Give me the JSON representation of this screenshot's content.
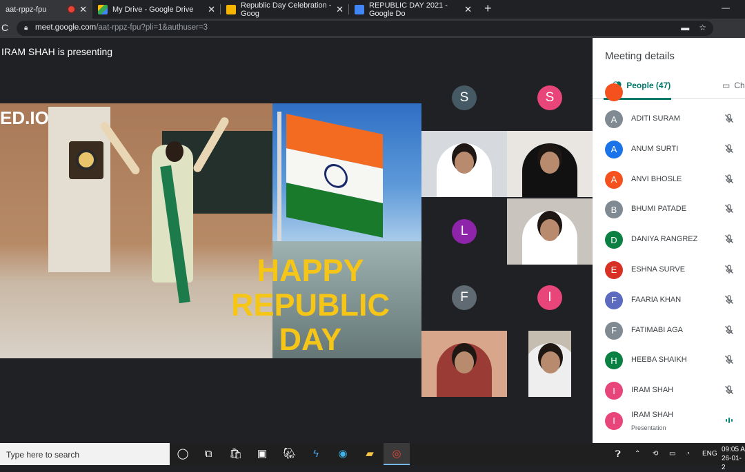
{
  "browser": {
    "tabs": [
      {
        "title": "aat-rppz-fpu",
        "active": true
      },
      {
        "title": "My Drive - Google Drive",
        "active": false
      },
      {
        "title": "Republic Day Celebration - Goog",
        "active": false
      },
      {
        "title": "REPUBLIC DAY 2021 - Google Do",
        "active": false
      }
    ],
    "new_tab": "+",
    "minimize": "—",
    "url_host": "meet.google.com",
    "url_path": "/aat-rppz-fpu?pli=1&authuser=3"
  },
  "meet": {
    "presenter_banner": "IRAM SHAH is presenting",
    "slide": {
      "brand_text": "ED.IO",
      "headline_lines": [
        "HAPPY",
        "REPUBLIC",
        "DAY"
      ]
    },
    "tiles": [
      {
        "type": "avatar",
        "letter": "S",
        "color": "#455a64"
      },
      {
        "type": "avatar",
        "letter": "S",
        "color": "#e8457a"
      },
      {
        "type": "video"
      },
      {
        "type": "video"
      },
      {
        "type": "avatar",
        "letter": "L",
        "color": "#8e24aa"
      },
      {
        "type": "video"
      },
      {
        "type": "avatar",
        "letter": "F",
        "color": "#5f6a72"
      },
      {
        "type": "avatar",
        "letter": "I",
        "color": "#e8457a"
      },
      {
        "type": "video"
      },
      {
        "type": "video"
      }
    ]
  },
  "panel": {
    "title": "Meeting details",
    "people_tab": "People (47)",
    "chat_tab": "Ch",
    "participants": [
      {
        "initial": "A",
        "name": "ADITI SURAM",
        "color": "#7f8a92",
        "sub": "",
        "muted": true
      },
      {
        "initial": "A",
        "name": "ANUM SURTI",
        "color": "#1a73e8",
        "sub": "",
        "muted": true
      },
      {
        "initial": "A",
        "name": "ANVI BHOSLE",
        "color": "#f4511e",
        "sub": "",
        "muted": true
      },
      {
        "initial": "B",
        "name": "BHUMI PATADE",
        "color": "#7f8a92",
        "sub": "",
        "muted": true
      },
      {
        "initial": "D",
        "name": "DANIYA RANGREZ",
        "color": "#0b8043",
        "sub": "",
        "muted": true
      },
      {
        "initial": "E",
        "name": "ESHNA SURVE",
        "color": "#d93025",
        "sub": "",
        "muted": true
      },
      {
        "initial": "F",
        "name": "FAARIA KHAN",
        "color": "#5c6bc0",
        "sub": "",
        "muted": true
      },
      {
        "initial": "F",
        "name": "FATIMABI AGA",
        "color": "#7f8a92",
        "sub": "",
        "muted": true
      },
      {
        "initial": "H",
        "name": "HEEBA SHAIKH",
        "color": "#0b8043",
        "sub": "",
        "muted": true
      },
      {
        "initial": "I",
        "name": "IRAM SHAH",
        "color": "#e8457a",
        "sub": "",
        "muted": true
      },
      {
        "initial": "I",
        "name": "IRAM SHAH",
        "color": "#e8457a",
        "sub": "Presentation",
        "muted": false
      }
    ]
  },
  "taskbar": {
    "search_placeholder": "Type here to search",
    "language": "ENG",
    "time": "09:05 A",
    "date": "26-01-2"
  }
}
